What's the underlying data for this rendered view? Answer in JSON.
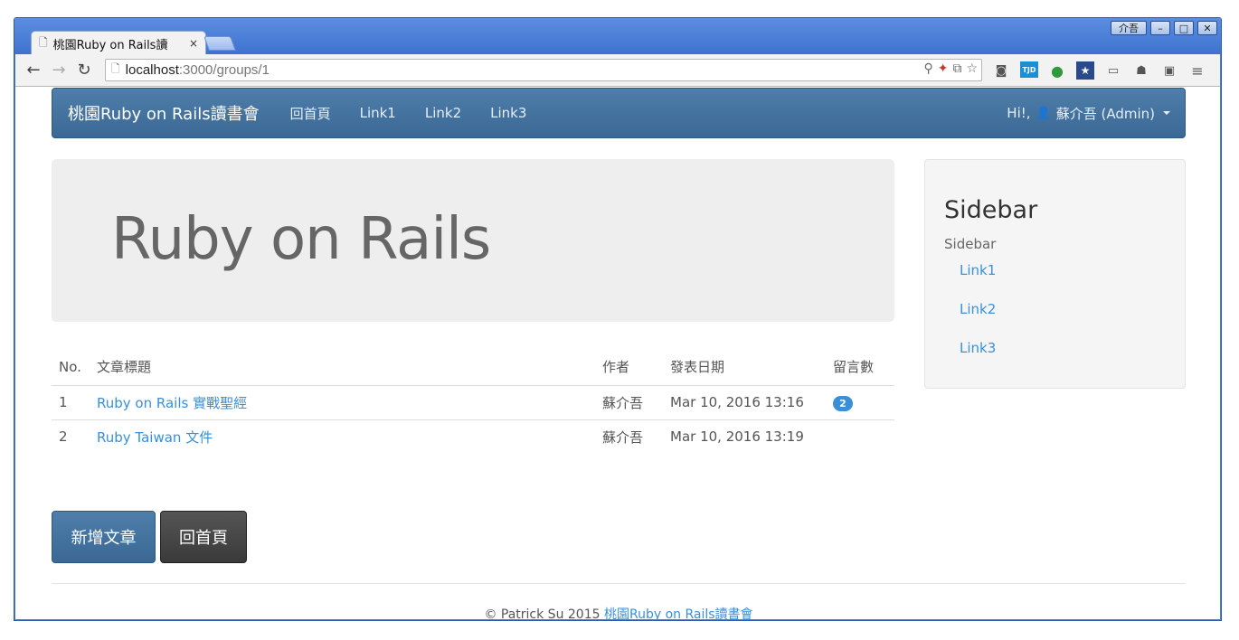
{
  "browser": {
    "tab_title": "桃園Ruby on Rails讀",
    "tab_close": "×",
    "user_badge": "介吾",
    "url_host": "localhost",
    "url_path": ":3000/groups/1",
    "icons": [
      "back-icon",
      "forward-icon",
      "reload-icon",
      "page-icon",
      "search-icon",
      "star-icon",
      "camera-icon",
      "tjd-icon",
      "leaf-icon",
      "bookmark-star-icon",
      "cast-icon",
      "cat-icon",
      "extension-icon",
      "menu-icon"
    ]
  },
  "navbar": {
    "brand": "桃園Ruby on Rails讀書會",
    "links": [
      "回首頁",
      "Link1",
      "Link2",
      "Link3"
    ],
    "greeting": "Hi!,",
    "user": "蘇介吾 (Admin)"
  },
  "jumbotron": {
    "title": "Ruby on Rails"
  },
  "table": {
    "headers": [
      "No.",
      "文章標題",
      "作者",
      "發表日期",
      "留言數"
    ],
    "rows": [
      {
        "no": "1",
        "title": "Ruby on Rails 實戰聖經",
        "author": "蘇介吾",
        "date": "Mar 10, 2016 13:16",
        "comments": "2"
      },
      {
        "no": "2",
        "title": "Ruby Taiwan 文件",
        "author": "蘇介吾",
        "date": "Mar 10, 2016 13:19",
        "comments": ""
      }
    ]
  },
  "buttons": {
    "new_post": "新增文章",
    "home": "回首頁"
  },
  "sidebar": {
    "title": "Sidebar",
    "subtitle": "Sidebar",
    "links": [
      "Link1",
      "Link2",
      "Link3"
    ]
  },
  "footer": {
    "copyright": "© Patrick Su 2015",
    "link": "桃園Ruby on Rails讀書會"
  },
  "colors": {
    "navbar": "#3f6d98",
    "link": "#3a8fd8",
    "jumbotron": "#eeeeee"
  }
}
